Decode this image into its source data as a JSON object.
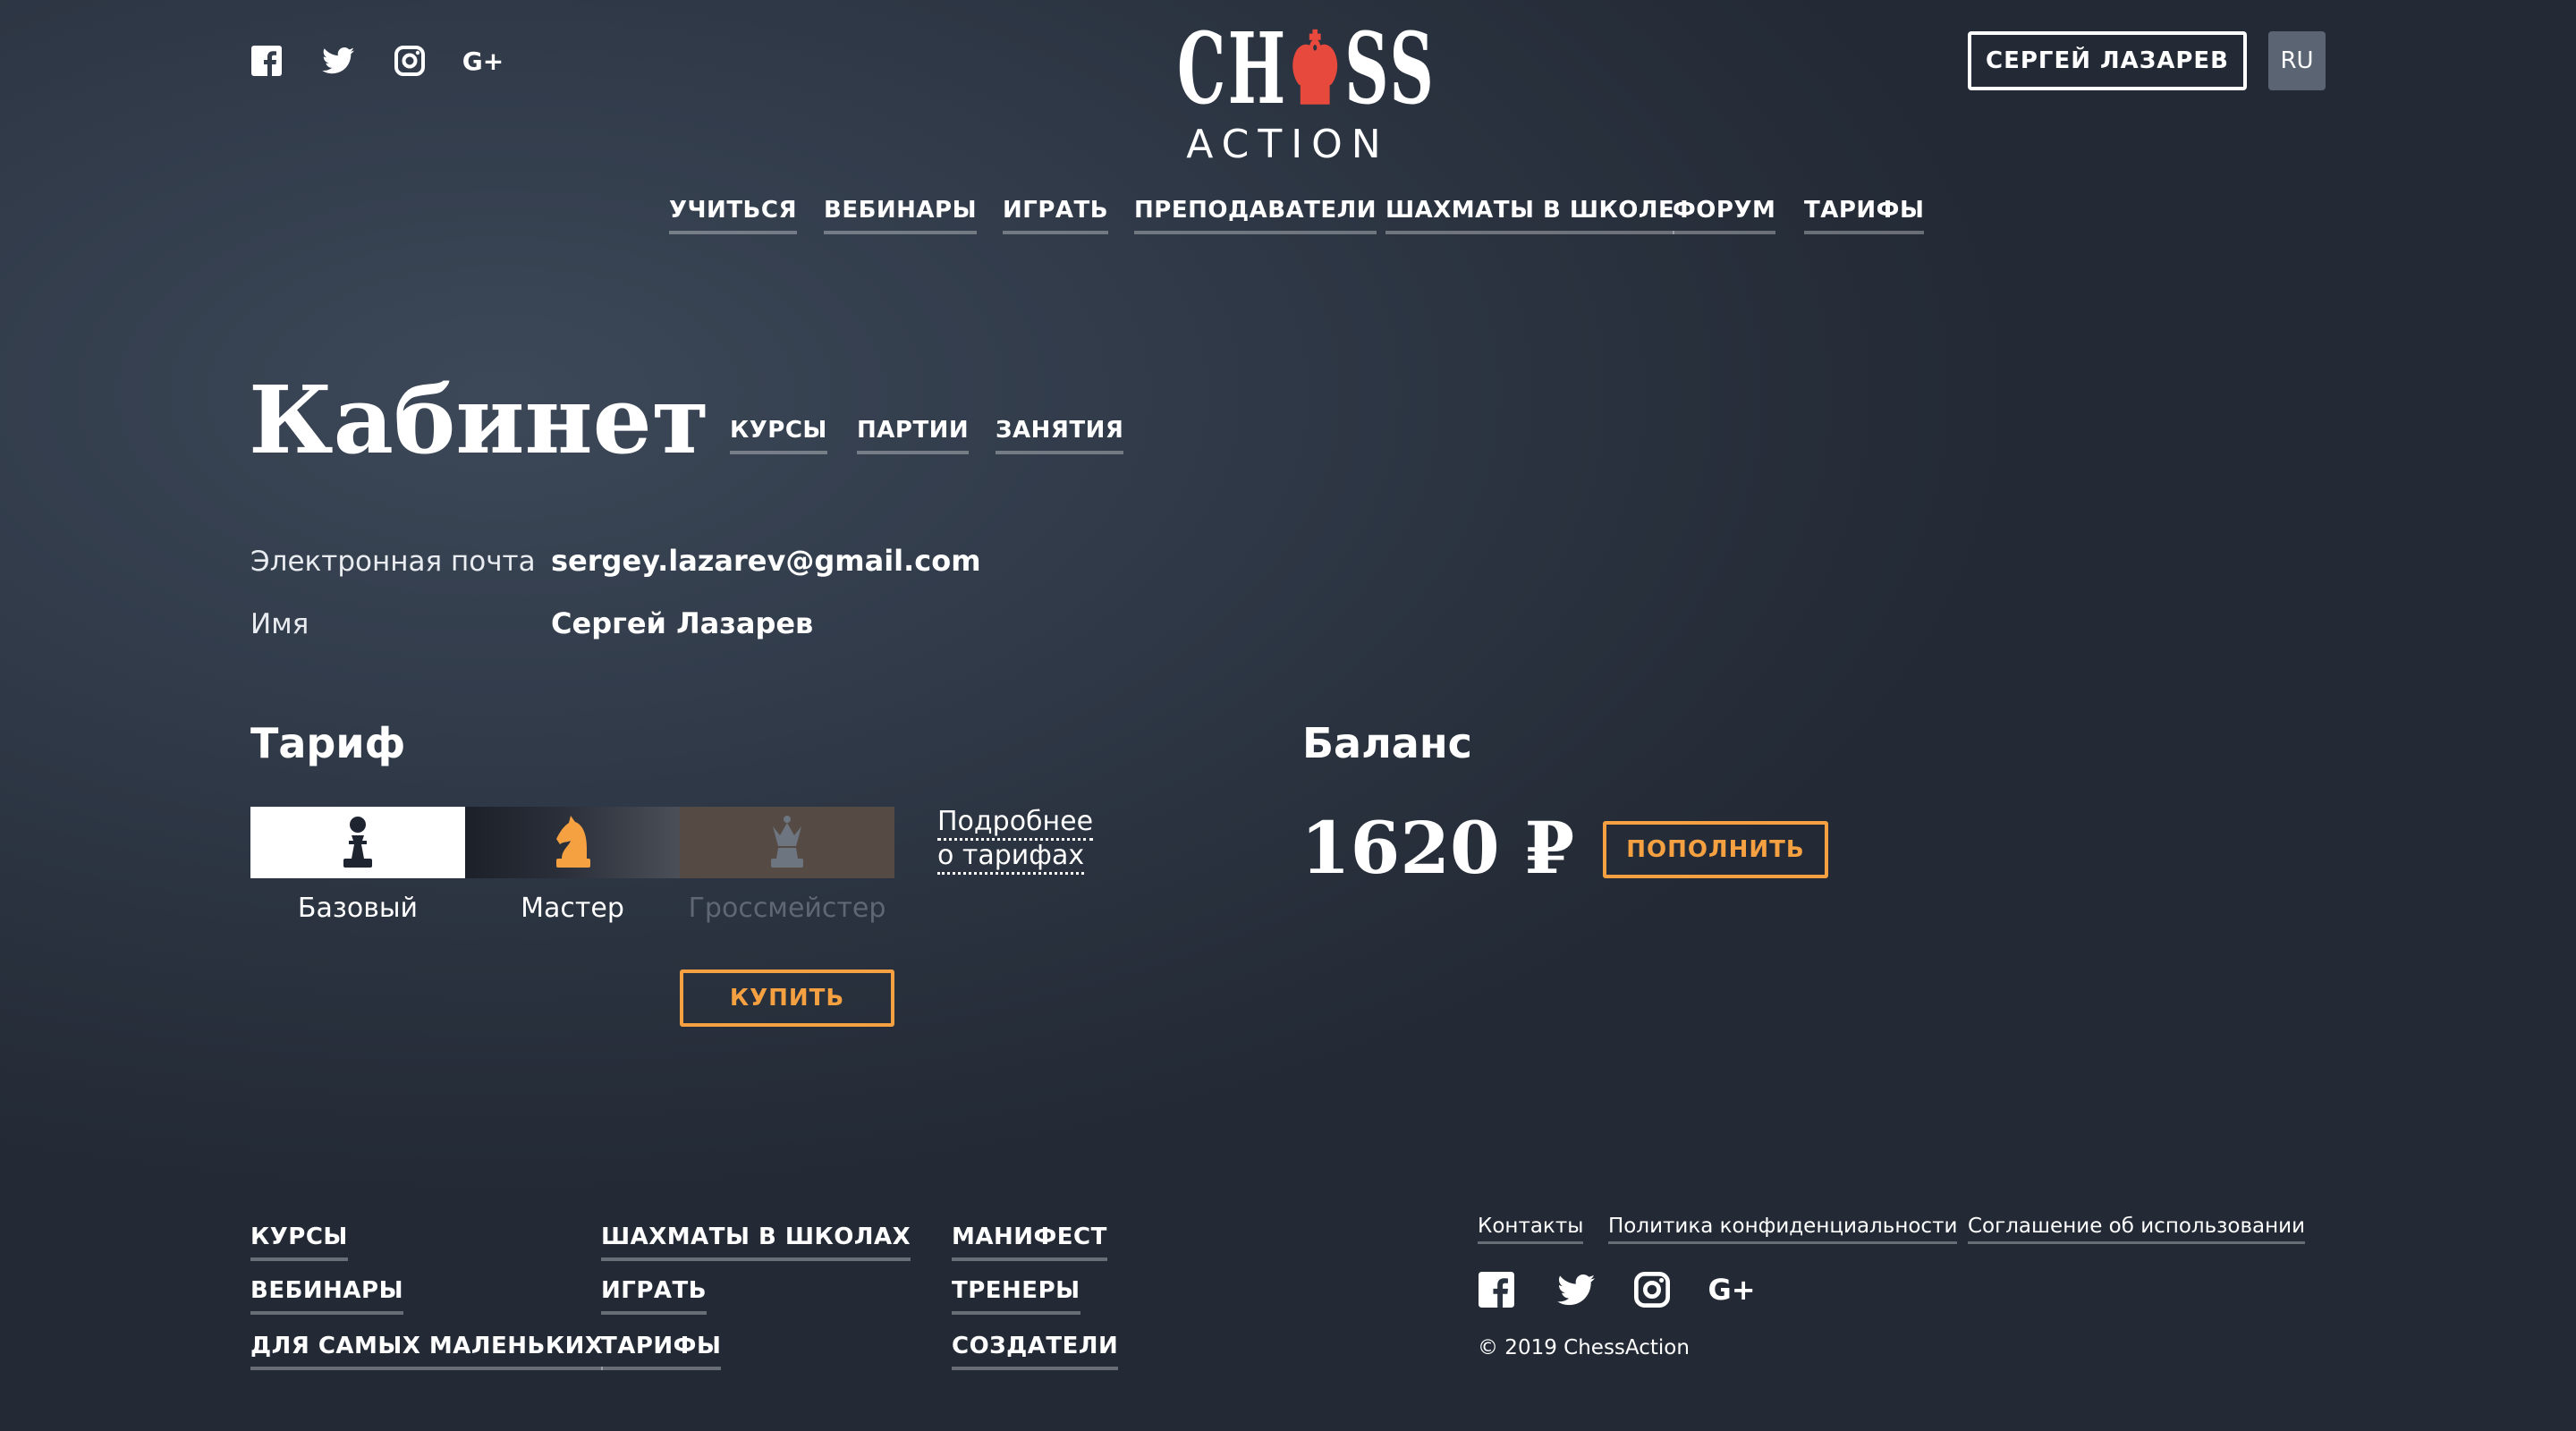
{
  "header": {
    "social_icons": [
      "facebook-icon",
      "twitter-icon",
      "instagram-icon",
      "google-plus-icon"
    ],
    "gplus_text": "G+",
    "logo": {
      "line1_a": "CH",
      "line1_b": "SS",
      "line2": "ACTION"
    },
    "user_button": "СЕРГЕЙ ЛАЗАРЕВ",
    "language": "RU"
  },
  "nav": [
    "УЧИТЬСЯ",
    "ВЕБИНАРЫ",
    "ИГРАТЬ",
    "ПРЕПОДАВАТЕЛИ",
    "ШАХМАТЫ В ШКОЛЕ",
    "ФОРУМ",
    "ТАРИФЫ"
  ],
  "cabinet": {
    "title": "Кабинет",
    "tabs": [
      "КУРСЫ",
      "ПАРТИИ",
      "ЗАНЯТИЯ"
    ],
    "email_label": "Электронная почта",
    "email_value": "sergey.lazarev@gmail.com",
    "name_label": "Имя",
    "name_value": "Сергей Лазарев"
  },
  "tariff": {
    "title": "Тариф",
    "plans": [
      {
        "name": "Базовый",
        "piece": "pawn-icon"
      },
      {
        "name": "Мастер",
        "piece": "knight-icon"
      },
      {
        "name": "Гроссмейстер",
        "piece": "queen-icon"
      }
    ],
    "more_line1": "Подробнее",
    "more_line2": "о тарифах",
    "buy_button": "КУПИТЬ"
  },
  "balance": {
    "title": "Баланс",
    "amount": "1620 ₽",
    "topup_button": "ПОПОЛНИТЬ"
  },
  "footer": {
    "col1": [
      "КУРСЫ",
      "ВЕБИНАРЫ",
      "ДЛЯ САМЫХ МАЛЕНЬКИХ"
    ],
    "col2": [
      "ШАХМАТЫ В ШКОЛАХ",
      "ИГРАТЬ",
      "ТАРИФЫ"
    ],
    "col3": [
      "МАНИФЕСТ",
      "ТРЕНЕРЫ",
      "СОЗДАТЕЛИ"
    ],
    "links": [
      "Контакты",
      "Политика конфиденциальности",
      "Соглашение об использовании"
    ],
    "copyright": "© 2019 ChessAction"
  },
  "colors": {
    "accent": "#f5a142",
    "logo_red": "#e8493d",
    "bg": "#2e3745"
  }
}
